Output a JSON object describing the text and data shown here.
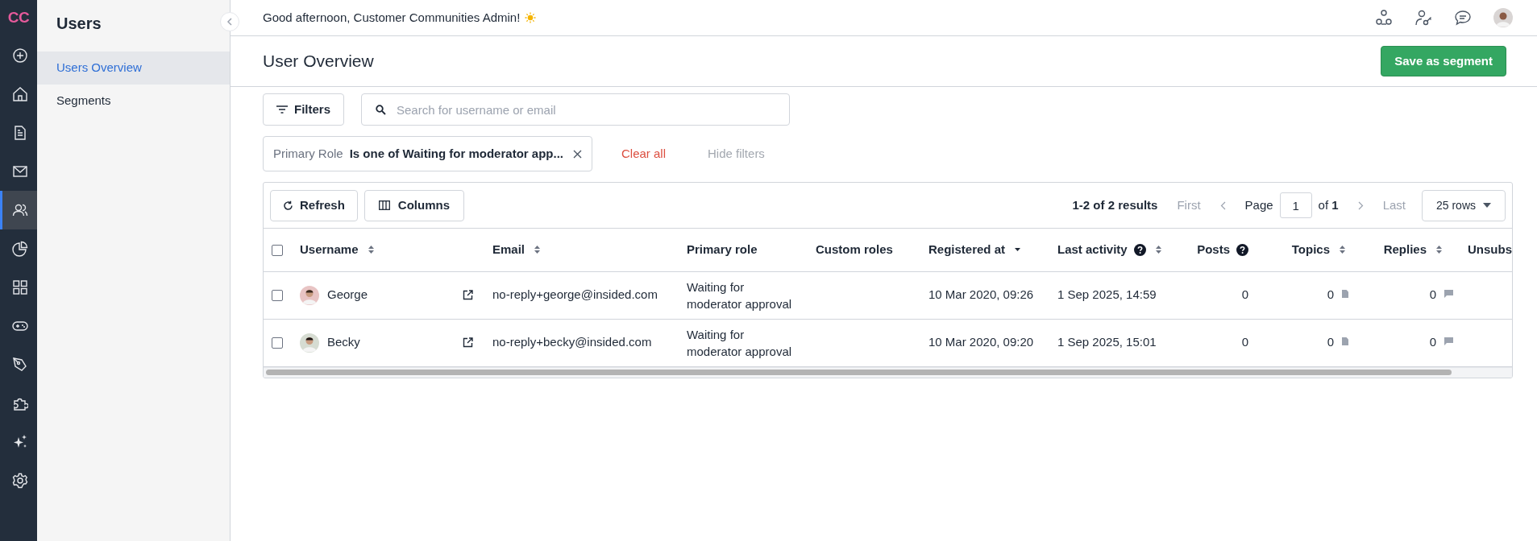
{
  "rail": {
    "logo": "CC",
    "items": [
      {
        "selected": false
      },
      {
        "selected": false
      },
      {
        "selected": false
      },
      {
        "selected": false
      },
      {
        "selected": true
      },
      {
        "selected": false
      },
      {
        "selected": false
      },
      {
        "selected": false
      },
      {
        "selected": false
      },
      {
        "selected": false
      },
      {
        "selected": false
      },
      {
        "selected": false
      }
    ]
  },
  "sidebar": {
    "title": "Users",
    "items": [
      {
        "label": "Users Overview",
        "selected": true
      },
      {
        "label": "Segments",
        "selected": false
      }
    ]
  },
  "topbar": {
    "greeting": "Good afternoon, Customer Communities Admin!"
  },
  "header": {
    "title": "User Overview",
    "save_button": "Save as segment"
  },
  "filters": {
    "button": "Filters",
    "search_placeholder": "Search for username or email",
    "chip": {
      "field": "Primary Role",
      "value": "Is one of Waiting for moderator app..."
    },
    "clear_all": "Clear all",
    "hide_filters": "Hide filters"
  },
  "toolbar": {
    "refresh": "Refresh",
    "columns": "Columns",
    "results": "1-2 of 2 results",
    "pager": {
      "first": "First",
      "first_disabled": true,
      "page_label": "Page",
      "page": "1",
      "of": "of",
      "total": "1",
      "last": "Last",
      "last_disabled": true
    },
    "rows_select": "25 rows"
  },
  "table": {
    "select_all_checked": false,
    "columns": [
      {
        "label": "Username",
        "sortable": true,
        "sorted": false,
        "help": false,
        "numeric": false
      },
      {
        "label": "Email",
        "sortable": true,
        "sorted": false,
        "help": false,
        "numeric": false
      },
      {
        "label": "Primary role",
        "sortable": false,
        "sorted": false,
        "help": false,
        "numeric": false
      },
      {
        "label": "Custom roles",
        "sortable": false,
        "sorted": false,
        "help": false,
        "numeric": false
      },
      {
        "label": "Registered at",
        "sortable": true,
        "sorted": true,
        "help": false,
        "numeric": false
      },
      {
        "label": "Last activity",
        "sortable": true,
        "sorted": false,
        "help": true,
        "numeric": false
      },
      {
        "label": "Posts",
        "sortable": false,
        "sorted": false,
        "help": true,
        "numeric": true
      },
      {
        "label": "Topics",
        "sortable": true,
        "sorted": false,
        "help": false,
        "numeric": true
      },
      {
        "label": "Replies",
        "sortable": true,
        "sorted": false,
        "help": false,
        "numeric": true
      },
      {
        "label": "Unsubs",
        "numeric": false
      }
    ],
    "rows": [
      {
        "checked": false,
        "username": "George",
        "email": "no-reply+george@insided.com",
        "primary_role": "Waiting for moderator approval",
        "registered_at": "10 Mar 2020, 09:26",
        "last_activity": "1 Sep 2025, 14:59",
        "posts": "0",
        "topics": "0",
        "replies": "0"
      },
      {
        "checked": false,
        "username": "Becky",
        "email": "no-reply+becky@insided.com",
        "primary_role": "Waiting for moderator approval",
        "registered_at": "10 Mar 2020, 09:20",
        "last_activity": "1 Sep 2025, 15:01",
        "posts": "0",
        "topics": "0",
        "replies": "0"
      }
    ]
  }
}
